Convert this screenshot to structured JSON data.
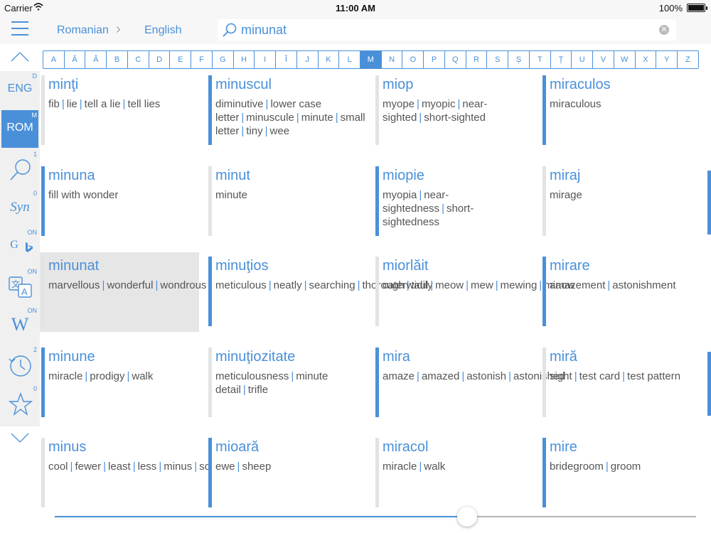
{
  "status": {
    "carrier": "Carrier",
    "time": "11:00 AM",
    "battery": "100%"
  },
  "nav": {
    "from": "Romanian",
    "to": "English",
    "separator": "›"
  },
  "search": {
    "value": "minunat",
    "placeholder": ""
  },
  "alphabet": {
    "letters": [
      "A",
      "Ă",
      "Â",
      "B",
      "C",
      "D",
      "E",
      "F",
      "G",
      "H",
      "I",
      "Î",
      "J",
      "K",
      "L",
      "M",
      "N",
      "O",
      "P",
      "Q",
      "R",
      "S",
      "Ș",
      "T",
      "Ț",
      "U",
      "V",
      "W",
      "X",
      "Y",
      "Z"
    ],
    "active": "M"
  },
  "sidebar": {
    "eng": {
      "label": "ENG",
      "badge": "D"
    },
    "rom": {
      "label": "ROM",
      "badge": "M"
    },
    "search": {
      "badge": "1"
    },
    "syn": {
      "label": "Syn",
      "badge": "0"
    },
    "google": {
      "label": "G",
      "badge": "ON"
    },
    "translate": {
      "badge": "ON"
    },
    "wiki": {
      "label": "W",
      "badge": "ON"
    },
    "history": {
      "badge": "2"
    },
    "favorites": {
      "badge": "0"
    }
  },
  "entries": [
    {
      "word": "minţi",
      "trans": [
        "fib",
        "lie",
        "tell a lie",
        "tell lies"
      ],
      "bar": "grey"
    },
    {
      "word": "minuscul",
      "trans": [
        "diminutive",
        "lower case letter",
        "minuscule",
        "minute",
        "small letter",
        "tiny",
        "wee"
      ],
      "bar": "blue"
    },
    {
      "word": "miop",
      "trans": [
        "myope",
        "myopic",
        "near-sighted",
        "short-sighted"
      ],
      "bar": "grey"
    },
    {
      "word": "miraculos",
      "trans": [
        "miraculous"
      ],
      "bar": "blue"
    },
    {
      "word": "minuna",
      "trans": [
        "fill with wonder"
      ],
      "bar": "blue"
    },
    {
      "word": "minut",
      "trans": [
        "minute"
      ],
      "bar": "grey"
    },
    {
      "word": "miopie",
      "trans": [
        "myopia",
        "near-sightedness",
        "short-sightedness"
      ],
      "bar": "blue"
    },
    {
      "word": "miraj",
      "trans": [
        "mirage"
      ],
      "bar": "grey"
    },
    {
      "word": "minunat",
      "trans": [
        "marvellous",
        "wonderful",
        "wondrous"
      ],
      "bar": "grey",
      "selected": true
    },
    {
      "word": "minuţios",
      "trans": [
        "meticulous",
        "neatly",
        "searching",
        "thorough",
        "tidily"
      ],
      "bar": "blue"
    },
    {
      "word": "miorlăit",
      "trans": [
        "caterwaul",
        "meow",
        "mew",
        "mewing",
        "miaow"
      ],
      "bar": "grey"
    },
    {
      "word": "mirare",
      "trans": [
        "amazement",
        "astonishment"
      ],
      "bar": "blue"
    },
    {
      "word": "minune",
      "trans": [
        "miracle",
        "prodigy",
        "walk"
      ],
      "bar": "blue"
    },
    {
      "word": "minuţiozitate",
      "trans": [
        "meticulousness",
        "minute detail",
        "trifle"
      ],
      "bar": "grey"
    },
    {
      "word": "mira",
      "trans": [
        "amaze",
        "amazed",
        "astonish",
        "astonished"
      ],
      "bar": "blue"
    },
    {
      "word": "miră",
      "trans": [
        "sight",
        "test card",
        "test pattern"
      ],
      "bar": "grey"
    },
    {
      "word": "minus",
      "trans": [
        "cool",
        "fewer",
        "least",
        "less",
        "minus",
        "so"
      ],
      "bar": "grey"
    },
    {
      "word": "mioară",
      "trans": [
        "ewe",
        "sheep"
      ],
      "bar": "blue"
    },
    {
      "word": "miracol",
      "trans": [
        "miracle",
        "walk"
      ],
      "bar": "grey"
    },
    {
      "word": "mire",
      "trans": [
        "bridegroom",
        "groom"
      ],
      "bar": "blue"
    }
  ],
  "slider": {
    "value": 0.643
  }
}
